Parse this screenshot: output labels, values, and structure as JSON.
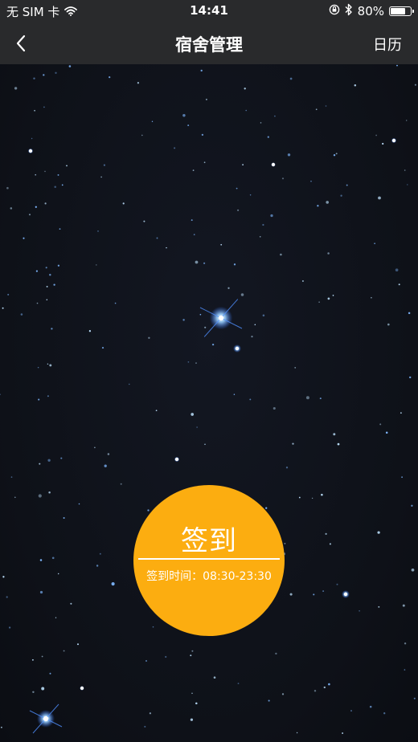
{
  "status_bar": {
    "carrier": "无 SIM 卡",
    "time": "14:41",
    "battery": "80%",
    "battery_level": 0.8,
    "icons": [
      "wifi-icon",
      "orientation-lock-icon",
      "bluetooth-icon",
      "battery-icon"
    ]
  },
  "nav": {
    "back_icon": "chevron-left-icon",
    "title": "宿舍管理",
    "action_label": "日历"
  },
  "checkin": {
    "label": "签到",
    "hours": "签到时间：08:30-23:30",
    "color": "#fcad10"
  },
  "colors": {
    "bar_background": "#292a2c",
    "sky": "#0f1219",
    "star": "#bfe3ff"
  }
}
